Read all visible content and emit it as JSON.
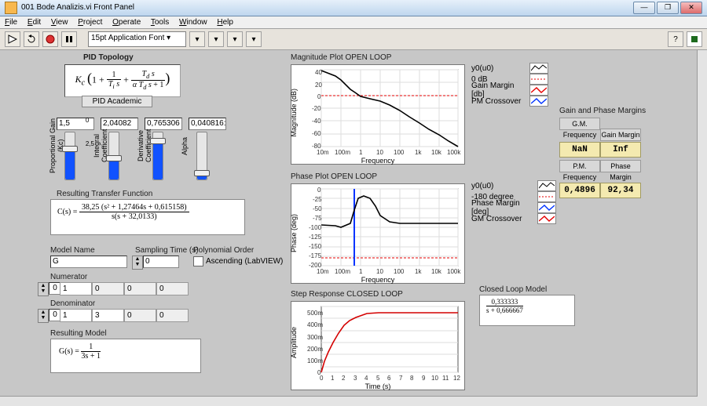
{
  "window": {
    "title": "001 Bode Analizis.vi Front Panel"
  },
  "menu": {
    "file": "File",
    "edit": "Edit",
    "view": "View",
    "project": "Project",
    "operate": "Operate",
    "tools": "Tools",
    "window": "Window",
    "help": "Help"
  },
  "toolbar": {
    "font": "15pt Application Font"
  },
  "topology": {
    "title": "PID Topology",
    "type": "PID Academic",
    "formula": "Kc ( 1 + 1/(Ti s) + (Td s)/(α Td s + 1) )"
  },
  "sliders": {
    "kc": {
      "caption": "Proportional Gain (Kc)",
      "value": "1,5",
      "max": "2,5",
      "min": "0",
      "fill": 0.6
    },
    "ti": {
      "caption": "Integral Coefficient",
      "value": "2,04082",
      "max": "5",
      "min": "0",
      "fill": 0.41
    },
    "td": {
      "caption": "Derivative Coefficient",
      "value": "0,765306",
      "max": "1",
      "min": "0",
      "fill": 0.77
    },
    "alpha": {
      "caption": "Alpha",
      "value": "0,040816:",
      "max": "0,5",
      "min": "0",
      "fill": 0.08
    }
  },
  "rtf": {
    "title": "Resulting Transfer Function",
    "eq": "C(s) = 38,25 (s² + 1,27464s + 0,615158) / ( s(s + 32,0133) )"
  },
  "model": {
    "name_lbl": "Model Name",
    "name_val": "G",
    "samp_lbl": "Sampling Time (s)",
    "samp_val": "0",
    "poly_lbl": "Polynomial Order",
    "asc_lbl": "Ascending (LabVIEW)",
    "num_lbl": "Numerator",
    "num_idx": "0",
    "num_cells": [
      "1",
      "0",
      "0",
      "0"
    ],
    "den_lbl": "Denominator",
    "den_idx": "0",
    "den_cells": [
      "1",
      "3",
      "0",
      "0"
    ],
    "res_lbl": "Resulting Model",
    "res_eq": "G(s) = 1 / (3s + 1)"
  },
  "closed_model": {
    "title": "Closed Loop Model",
    "eq": "0,333333 / (s + 0,666667)"
  },
  "legend_mag": {
    "items": [
      "y0(u0)",
      "0 dB",
      "Gain Margin [db]",
      "PM Crossover"
    ]
  },
  "legend_phase": {
    "items": [
      "y0(u0)",
      "-180 degree",
      "Phase Margin [deg]",
      "GM Crossover"
    ]
  },
  "margins": {
    "title": "Gain and Phase Margins",
    "h1": "G.M. Frequency",
    "h2": "Gain Margin",
    "v1": "NaN",
    "v2": "Inf",
    "h3": "P.M. Frequency",
    "h4": "Phase Margin",
    "v3": "0,4896",
    "v4": "92,34"
  },
  "chart_data": [
    {
      "type": "line",
      "id": "mag",
      "title": "Magnitude Plot  OPEN LOOP",
      "xlabel": "Frequency",
      "ylabel": "Magnitude (dB)",
      "xscale": "log",
      "xlim": [
        0.01,
        100000
      ],
      "ylim": [
        -80,
        40
      ],
      "xticks": [
        "10m",
        "100m",
        "1",
        "10",
        "100",
        "1k",
        "10k",
        "100k"
      ],
      "yticks": [
        40,
        20,
        0,
        -20,
        -40,
        -60,
        -80
      ],
      "series": [
        {
          "name": "y0(u0)",
          "color": "#000",
          "x": [
            0.01,
            0.05,
            0.1,
            0.3,
            0.5,
            1,
            3,
            10,
            30,
            100,
            300,
            1000,
            3000,
            10000,
            30000,
            100000
          ],
          "y": [
            39,
            30,
            24,
            10,
            5,
            -2,
            -5,
            -9,
            -15,
            -24,
            -33,
            -43,
            -53,
            -62,
            -72,
            -80
          ]
        }
      ],
      "refs": [
        {
          "name": "0 dB",
          "axis": "y",
          "value": 0,
          "color": "#e60000",
          "dash": true
        }
      ]
    },
    {
      "type": "line",
      "id": "phase",
      "title": "Phase Plot  OPEN LOOP",
      "xlabel": "Frequency",
      "ylabel": "Phase (deg)",
      "xscale": "log",
      "xlim": [
        0.01,
        100000
      ],
      "ylim": [
        -200,
        0
      ],
      "xticks": [
        "10m",
        "100m",
        "1",
        "10",
        "100",
        "1k",
        "10k",
        "100k"
      ],
      "yticks": [
        0,
        -25,
        -50,
        -75,
        -100,
        -125,
        -150,
        -175,
        -200
      ],
      "series": [
        {
          "name": "y0(u0)",
          "color": "#000",
          "x": [
            0.01,
            0.05,
            0.1,
            0.3,
            0.49,
            0.8,
            1.5,
            3,
            6,
            12,
            30,
            100,
            300,
            1000,
            10000,
            100000
          ],
          "y": [
            -93,
            -96,
            -100,
            -90,
            -55,
            -25,
            -18,
            -25,
            -45,
            -70,
            -85,
            -90,
            -90,
            -90,
            -90,
            -90
          ]
        }
      ],
      "refs": [
        {
          "name": "-180",
          "axis": "y",
          "value": -180,
          "color": "#e60000",
          "dash": true
        },
        {
          "name": "PM cross",
          "axis": "x",
          "value": 0.4896,
          "color": "#0033ff",
          "dash": false,
          "ymin": -200,
          "ymax": 0
        }
      ]
    },
    {
      "type": "line",
      "id": "step",
      "title": "Step Response CLOSED LOOP",
      "xlabel": "Time (s)",
      "ylabel": "Amplitude",
      "xlim": [
        0,
        12
      ],
      "ylim": [
        0,
        0.55
      ],
      "xticks": [
        0,
        1,
        2,
        3,
        4,
        5,
        6,
        7,
        8,
        9,
        10,
        11,
        12
      ],
      "yticks": [
        "0",
        "100m",
        "200m",
        "300m",
        "400m",
        "500m"
      ],
      "series": [
        {
          "name": "step",
          "color": "#d40000",
          "x": [
            0,
            0.3,
            0.6,
            1,
            1.5,
            2,
            2.5,
            3,
            4,
            5,
            6,
            8,
            10,
            12
          ],
          "y": [
            0,
            0.09,
            0.17,
            0.25,
            0.33,
            0.39,
            0.43,
            0.46,
            0.49,
            0.495,
            0.498,
            0.5,
            0.5,
            0.5
          ]
        }
      ]
    }
  ]
}
